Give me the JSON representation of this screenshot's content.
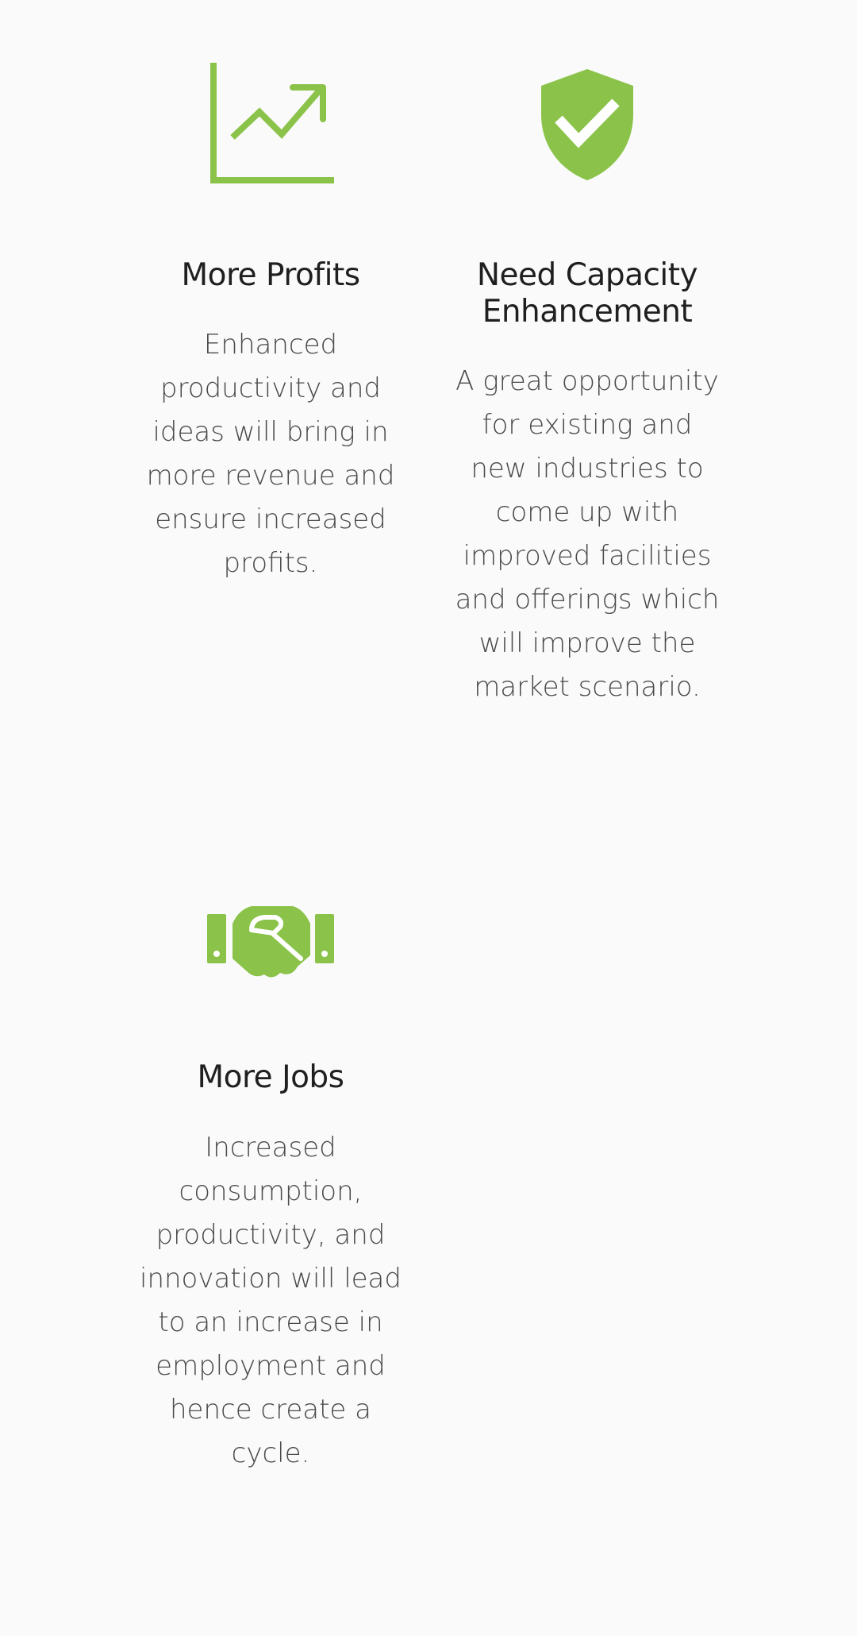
{
  "colors": {
    "accent": "#8bc34a",
    "title": "#1f1f1f",
    "text": "#4a4a4a",
    "background": "#fafafa"
  },
  "features": [
    {
      "icon": "chart-line-up-icon",
      "title": "More Profits",
      "description": "Enhanced productivity and ideas will bring in more revenue and ensure increased profits."
    },
    {
      "icon": "shield-check-icon",
      "title": "Need Capacity Enhancement",
      "description": "A great opportunity for existing and new industries to come up with improved facilities and offerings which will improve the market scenario."
    },
    {
      "icon": "handshake-icon",
      "title": "More Jobs",
      "description": "Increased consumption, productivity, and innovation will lead to an increase in employment and hence create a cycle."
    }
  ]
}
